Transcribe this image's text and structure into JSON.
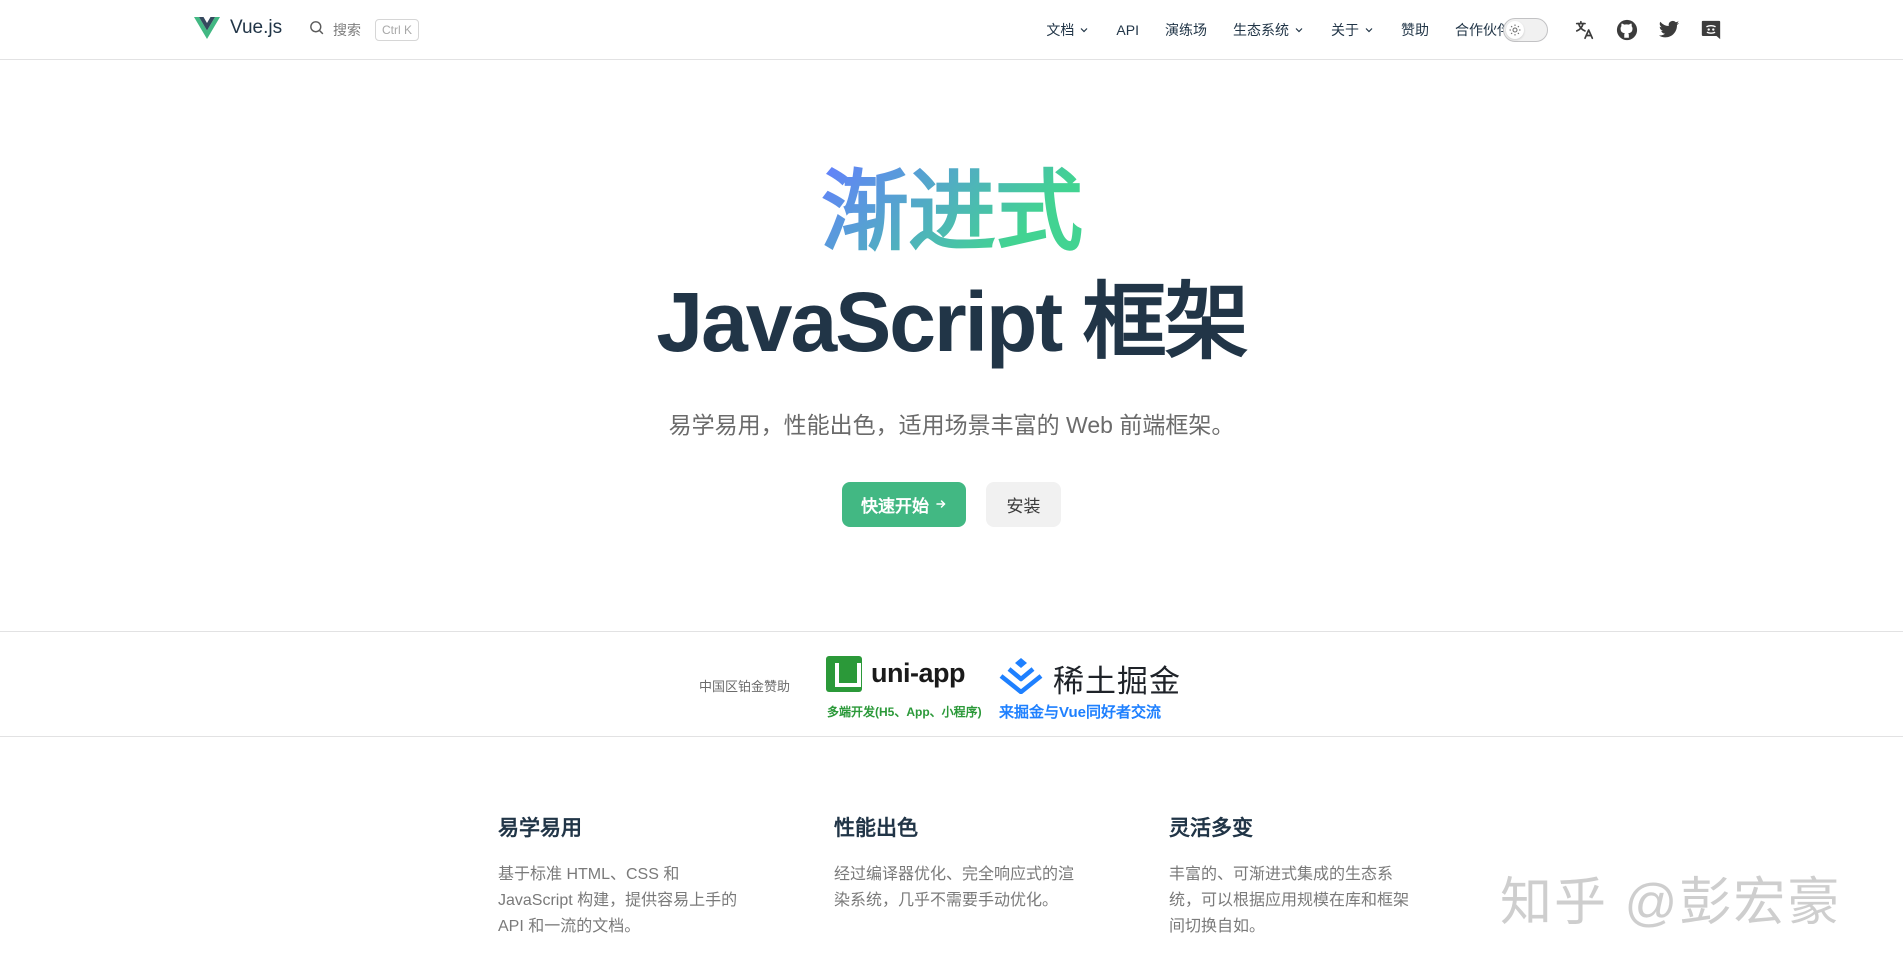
{
  "navbar": {
    "brand_title": "Vue.js",
    "search_label": "搜索",
    "search_shortcut": "Ctrl K",
    "links": [
      {
        "label": "文档",
        "has_dropdown": true
      },
      {
        "label": "API",
        "has_dropdown": false
      },
      {
        "label": "演练场",
        "has_dropdown": false
      },
      {
        "label": "生态系统",
        "has_dropdown": true
      },
      {
        "label": "关于",
        "has_dropdown": true
      },
      {
        "label": "赞助",
        "has_dropdown": false
      },
      {
        "label": "合作伙伴",
        "has_dropdown": false
      }
    ],
    "tools": [
      "translate-icon",
      "github-icon",
      "twitter-icon",
      "discord-icon"
    ]
  },
  "hero": {
    "tagline": "渐进式",
    "title": "JavaScript 框架",
    "description": "易学易用，性能出色，适用场景丰富的 Web 前端框架。",
    "primary_button": "快速开始",
    "secondary_button": "安装"
  },
  "sponsors": {
    "label": "中国区铂金赞助",
    "uniapp": {
      "name": "uni-app",
      "subtitle": "多端开发(H5、App、小程序)"
    },
    "xitu": {
      "name": "稀土掘金",
      "subtitle": "来掘金与Vue同好者交流"
    }
  },
  "features": [
    {
      "title": "易学易用",
      "text": "基于标准 HTML、CSS 和 JavaScript 构建，提供容易上手的 API 和一流的文档。"
    },
    {
      "title": "性能出色",
      "text": "经过编译器优化、完全响应式的渲染系统，几乎不需要手动优化。"
    },
    {
      "title": "灵活多变",
      "text": "丰富的、可渐进式集成的生态系统，可以根据应用规模在库和框架间切换自如。"
    }
  ],
  "watermark": "知乎 @彭宏豪",
  "colors": {
    "brand_green": "#42b883",
    "text_dark": "#213547",
    "gradient_start": "#42d392",
    "gradient_end": "#647eff",
    "uniapp_green": "#2b9939",
    "juejin_blue": "#1e80ff"
  }
}
